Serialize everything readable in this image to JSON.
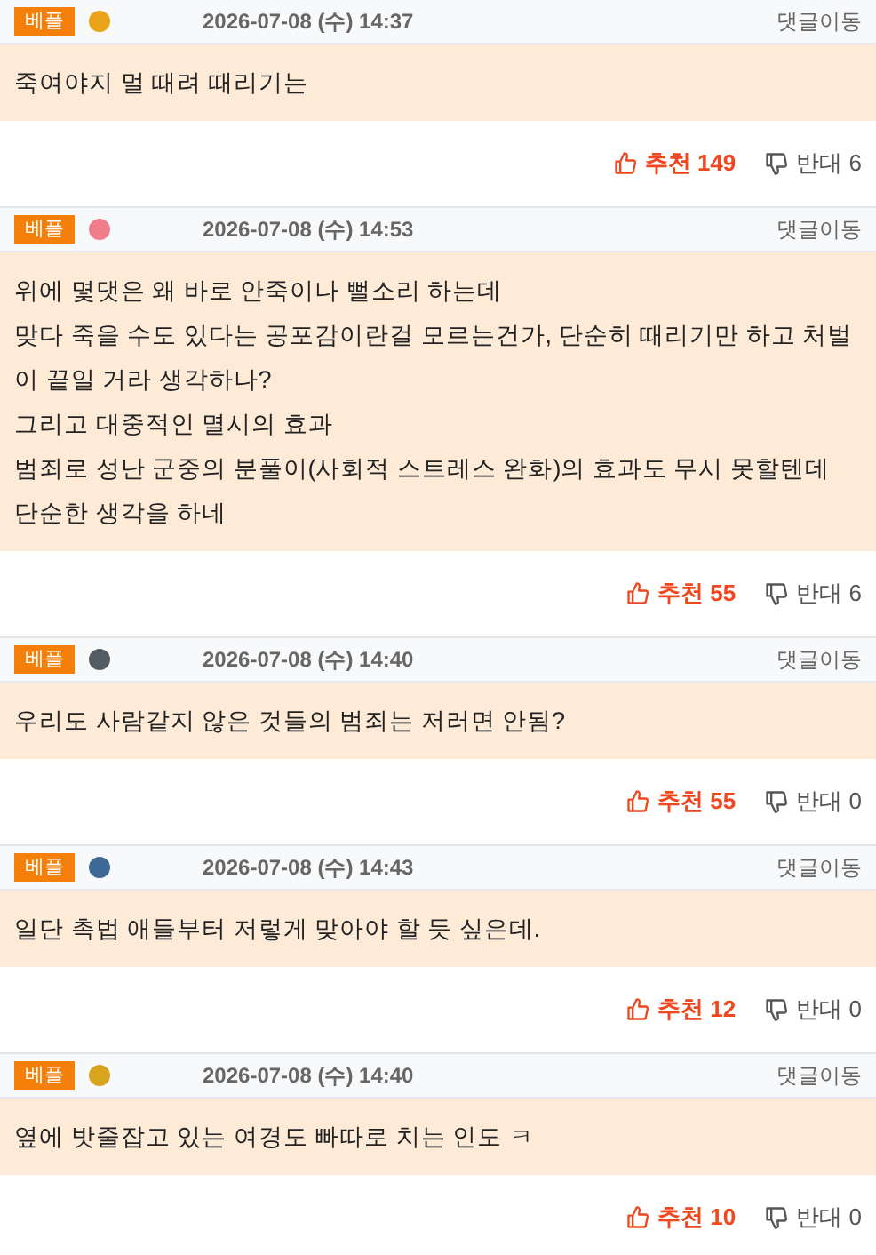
{
  "comments": [
    {
      "badge": "베플",
      "color": "#e8a317",
      "date": "2026-07-08 (수) 14:37",
      "jump": "댓글이동",
      "lines": [
        "죽여야지  멀 때려 때리기는"
      ],
      "up_label": "추천",
      "up": "149",
      "down_label": "반대",
      "down": "6"
    },
    {
      "badge": "베플",
      "color": "#f07c8c",
      "date": "2026-07-08 (수) 14:53",
      "jump": "댓글이동",
      "lines": [
        "위에 몇댓은 왜 바로 안죽이나 뻘소리 하는데",
        "맞다 죽을 수도 있다는 공포감이란걸 모르는건가, 단순히 때리기만 하고 처벌이 끝일 거라 생각하나?",
        "그리고 대중적인 멸시의 효과",
        "범죄로 성난 군중의 분풀이(사회적 스트레스 완화)의 효과도 무시 못할텐데",
        "단순한 생각을 하네"
      ],
      "up_label": "추천",
      "up": "55",
      "down_label": "반대",
      "down": "6"
    },
    {
      "badge": "베플",
      "color": "#555b63",
      "date": "2026-07-08 (수) 14:40",
      "jump": "댓글이동",
      "lines": [
        "우리도 사람같지 않은 것들의 범죄는 저러면 안됨?"
      ],
      "up_label": "추천",
      "up": "55",
      "down_label": "반대",
      "down": "0"
    },
    {
      "badge": "베플",
      "color": "#3d6a94",
      "date": "2026-07-08 (수) 14:43",
      "jump": "댓글이동",
      "lines": [
        "일단 촉법 애들부터 저렇게 맞아야 할 듯 싶은데."
      ],
      "up_label": "추천",
      "up": "12",
      "down_label": "반대",
      "down": "0"
    },
    {
      "badge": "베플",
      "color": "#d9a520",
      "date": "2026-07-08 (수) 14:40",
      "jump": "댓글이동",
      "lines": [
        "옆에 밧줄잡고 있는 여경도 빠따로 치는 인도 ㅋ"
      ],
      "up_label": "추천",
      "up": "10",
      "down_label": "반대",
      "down": "0"
    }
  ]
}
